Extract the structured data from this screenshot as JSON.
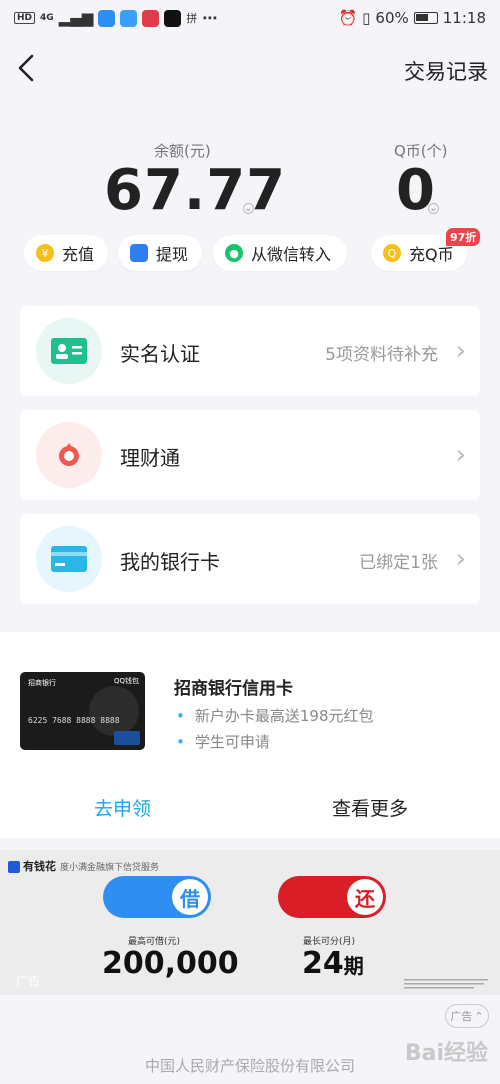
{
  "status_bar": {
    "network": "HD",
    "signal": "4G",
    "extra": "⋯",
    "battery": "60%",
    "time": "11:18"
  },
  "header": {
    "transactions_label": "交易记录"
  },
  "balance": {
    "label": "余额(元)",
    "value": "67.77"
  },
  "qcoin": {
    "label": "Q币(个)",
    "value": "0"
  },
  "actions": {
    "recharge": "充值",
    "withdraw": "提现",
    "wechat_transfer": "从微信转入",
    "buy_qcoin": "充Q币",
    "discount_badge": "97折"
  },
  "cards": [
    {
      "title": "实名认证",
      "subtitle": "5项资料待补充"
    },
    {
      "title": "理财通",
      "subtitle": ""
    },
    {
      "title": "我的银行卡",
      "subtitle": "已绑定1张"
    }
  ],
  "ad": {
    "card_bank": "招商银行",
    "card_number": "6225 7688 8888 8888",
    "card_brand": "QQ钱包",
    "title": "招商银行信用卡",
    "bullets": [
      "新户办卡最高送198元红包",
      "学生可申请"
    ],
    "apply_label": "去申领",
    "more_label": "查看更多"
  },
  "loan_banner": {
    "brand": "有钱花",
    "brand_desc": "度小满金融旗下信贷服务",
    "borrow_char": "借",
    "repay_char": "还",
    "max_label": "最高可借(元)",
    "max_value": "200,000",
    "term_label": "最长可分(月)",
    "term_value": "24",
    "term_unit": "期",
    "ad_tag": "广告",
    "borrow_color": "#2e8ef2",
    "repay_color": "#d91e27"
  },
  "ad_button": "广告",
  "footer": {
    "company": "中国人民财产保险股份有限公司",
    "line2": ""
  },
  "watermark": "Bai经验"
}
